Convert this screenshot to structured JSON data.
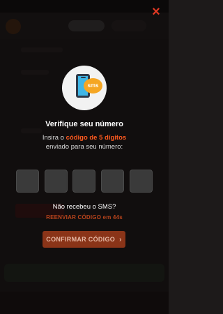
{
  "modal": {
    "close_icon": "×",
    "illustration_text": "sms",
    "title": "Verifique seu número",
    "sub_prefix": "Insira o ",
    "sub_highlight": "código de 5 dígitos",
    "sub_line2": "enviado para seu número:",
    "code_digits": [
      "",
      "",
      "",
      "",
      ""
    ],
    "no_sms_text": "Não recebeu o SMS?",
    "resend_label": "REENVIAR CÓDIGO em 44s",
    "confirm_label": "CONFIRMAR CÓDIGO",
    "confirm_icon": "›"
  },
  "colors": {
    "accent": "#ff5a1f",
    "close": "#e53a24",
    "confirm_bg": "#8a3418",
    "resend": "#b8441c"
  }
}
